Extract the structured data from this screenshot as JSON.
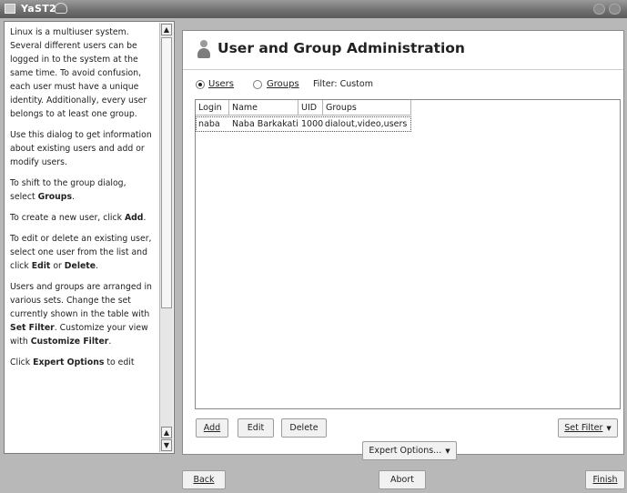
{
  "window": {
    "title": "YaST2"
  },
  "help": {
    "paragraphs": [
      "Linux is a multiuser system. Several different users can be logged in to the system at the same time. To avoid confusion, each user must have a unique identity. Additionally, every user belongs to at least one group.",
      "Use this dialog to get information about existing users and add or modify users.",
      "To shift to the group dialog, select <b>Groups</b>.",
      "To create a new user, click <b>Add</b>.",
      "To edit or delete an existing user, select one user from the list and click <b>Edit</b> or <b>Delete</b>.",
      "Users and groups are arranged in various sets. Change the set currently shown in the table with <b>Set Filter</b>. Customize your view with <b>Customize Filter</b>.",
      "Click <b>Expert Options</b> to edit"
    ]
  },
  "main": {
    "heading": "User and Group Administration",
    "view": {
      "users_label": "Users",
      "groups_label": "Groups",
      "selected": "Users",
      "filter_text": "Filter: Custom"
    },
    "table": {
      "columns": [
        "Login",
        "Name",
        "UID",
        "Groups"
      ],
      "rows": [
        {
          "login": "naba",
          "name": "Naba Barkakati",
          "uid": "1000",
          "groups": "dialout,video,users"
        }
      ]
    },
    "buttons": {
      "add": "Add",
      "edit": "Edit",
      "delete": "Delete",
      "set_filter": "Set Filter",
      "expert_options": "Expert Options..."
    }
  },
  "footer": {
    "back": "Back",
    "abort": "Abort",
    "finish": "Finish"
  },
  "icons": {
    "window": "yast-window-icon",
    "title_logo": "suse-chameleon-icon",
    "heading": "user-icon",
    "dropdown": "chevron-down-icon"
  }
}
